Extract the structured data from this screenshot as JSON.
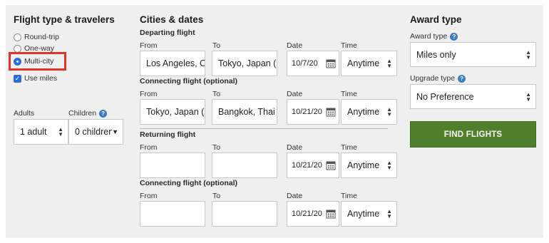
{
  "left": {
    "title": "Flight type & travelers",
    "options": {
      "round_trip": "Round-trip",
      "one_way": "One-way",
      "multi_city": "Multi-city",
      "use_miles": "Use miles"
    },
    "selected": "Multi-city",
    "use_miles_checked": true,
    "adults_label": "Adults",
    "children_label": "Children",
    "adults_value": "1 adult",
    "children_value": "0 children"
  },
  "middle": {
    "title": "Cities & dates",
    "col_labels": {
      "from": "From",
      "to": "To",
      "date": "Date",
      "time": "Time"
    },
    "segments": [
      {
        "label": "Departing flight",
        "from": "Los Angeles, C",
        "to": "Tokyo, Japan (",
        "date": "10/7/20",
        "time": "Anytime"
      },
      {
        "label": "Connecting flight (optional)",
        "from": "Tokyo, Japan (",
        "to": "Bangkok, Thai",
        "date": "10/21/20",
        "time": "Anytime"
      },
      {
        "label": "Returning flight",
        "from": "",
        "to": "",
        "date": "10/21/20",
        "time": "Anytime"
      },
      {
        "label": "Connecting flight (optional)",
        "from": "",
        "to": "",
        "date": "10/21/20",
        "time": "Anytime"
      }
    ]
  },
  "right": {
    "title": "Award type",
    "award_label": "Award type",
    "award_value": "Miles only",
    "upgrade_label": "Upgrade type",
    "upgrade_value": "No Preference",
    "find_button": "FIND FLIGHTS"
  },
  "colors": {
    "accent_blue": "#2b6fd6",
    "highlight_red": "#e0332a",
    "button_green": "#4f7f2a"
  }
}
